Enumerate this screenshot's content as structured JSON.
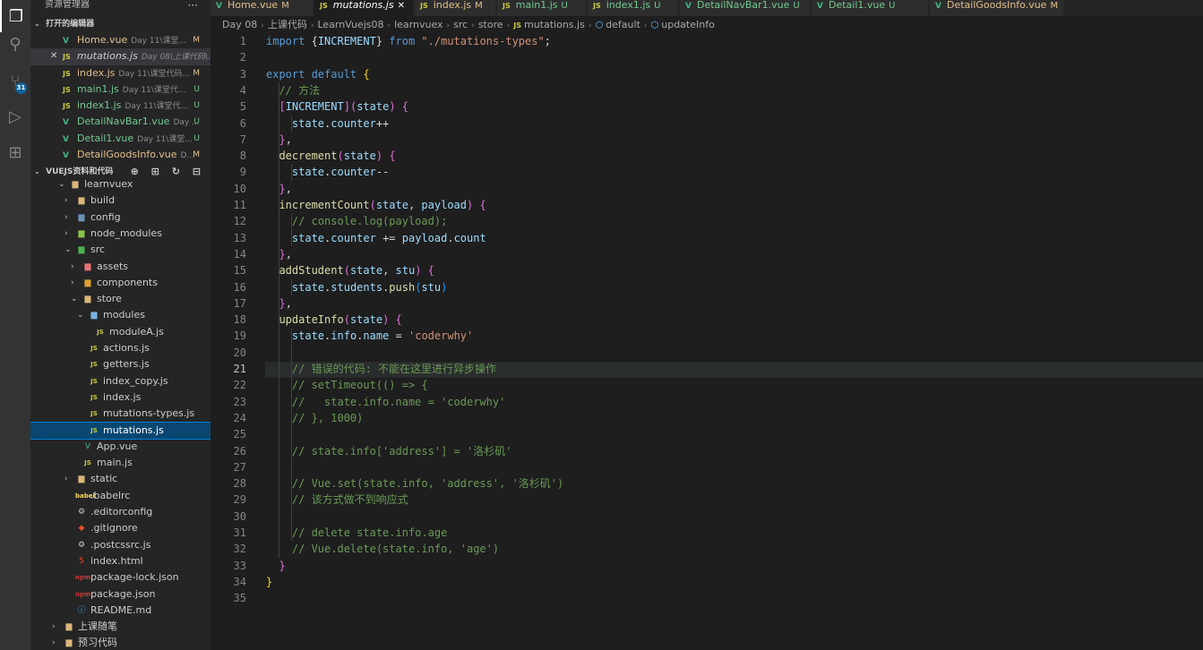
{
  "activity_bar": {
    "items": [
      {
        "name": "explorer-icon",
        "glyph": "❐"
      },
      {
        "name": "search-icon",
        "glyph": "⚲"
      },
      {
        "name": "source-control-icon",
        "glyph": "⑂"
      },
      {
        "name": "run-debug-icon",
        "glyph": "▷"
      },
      {
        "name": "extensions-icon",
        "glyph": "⊞"
      }
    ],
    "scm_badge": "31"
  },
  "sidebar": {
    "title": "资源管理器",
    "more": "···",
    "open_editors": {
      "header": "打开的编辑器",
      "items": [
        {
          "icon": "V",
          "name": "Home.vue",
          "path": "Day 11\\课堂...",
          "status": "M",
          "type": "vue"
        },
        {
          "icon": "JS",
          "name": "mutations.js",
          "path": "Day 08\\上课代码\\...",
          "status": "",
          "type": "js",
          "active": true,
          "close": "✕"
        },
        {
          "icon": "JS",
          "name": "index.js",
          "path": "Day 11\\课堂代码...",
          "status": "M",
          "type": "js"
        },
        {
          "icon": "JS",
          "name": "main1.js",
          "path": "Day 11\\课堂代...",
          "status": "U",
          "type": "js"
        },
        {
          "icon": "JS",
          "name": "index1.js",
          "path": "Day 11\\课堂代...",
          "status": "U",
          "type": "js"
        },
        {
          "icon": "V",
          "name": "DetailNavBar1.vue",
          "path": "Day ...",
          "status": "U",
          "type": "vue"
        },
        {
          "icon": "V",
          "name": "Detail1.vue",
          "path": "Day 11\\课堂...",
          "status": "U",
          "type": "vue"
        },
        {
          "icon": "V",
          "name": "DetailGoodsInfo.vue",
          "path": "D...",
          "status": "M",
          "type": "vue"
        }
      ]
    },
    "workspace": {
      "header": "VUEJS资料和代码",
      "tools": "⊕ ⊞ ↻ ⊟",
      "tree": [
        {
          "label": "learnvuex",
          "icon": "folder-open",
          "depth": 2,
          "arrow": "open"
        },
        {
          "label": "build",
          "icon": "folder",
          "depth": 3,
          "arrow": "closed"
        },
        {
          "label": "config",
          "icon": "folder",
          "depth": 3,
          "arrow": "closed"
        },
        {
          "label": "node_modules",
          "icon": "folder",
          "depth": 3,
          "arrow": "closed"
        },
        {
          "label": "src",
          "icon": "folder-open",
          "depth": 3,
          "arrow": "open"
        },
        {
          "label": "assets",
          "icon": "folder",
          "depth": 4,
          "arrow": "closed"
        },
        {
          "label": "components",
          "icon": "folder",
          "depth": 4,
          "arrow": "closed"
        },
        {
          "label": "store",
          "icon": "folder-open",
          "depth": 4,
          "arrow": "open"
        },
        {
          "label": "modules",
          "icon": "folder-open",
          "depth": 5,
          "arrow": "open"
        },
        {
          "label": "moduleA.js",
          "icon": "js",
          "depth": 6,
          "arrow": ""
        },
        {
          "label": "actions.js",
          "icon": "js",
          "depth": 5,
          "arrow": ""
        },
        {
          "label": "getters.js",
          "icon": "js",
          "depth": 5,
          "arrow": ""
        },
        {
          "label": "index_copy.js",
          "icon": "js",
          "depth": 5,
          "arrow": ""
        },
        {
          "label": "index.js",
          "icon": "js",
          "depth": 5,
          "arrow": ""
        },
        {
          "label": "mutations-types.js",
          "icon": "js",
          "depth": 5,
          "arrow": ""
        },
        {
          "label": "mutations.js",
          "icon": "js",
          "depth": 5,
          "arrow": "",
          "selected": true
        },
        {
          "label": "App.vue",
          "icon": "vue",
          "depth": 4,
          "arrow": ""
        },
        {
          "label": "main.js",
          "icon": "js",
          "depth": 4,
          "arrow": ""
        },
        {
          "label": "static",
          "icon": "folder",
          "depth": 3,
          "arrow": "closed"
        },
        {
          "label": ".babelrc",
          "icon": "babel",
          "depth": 3,
          "arrow": ""
        },
        {
          "label": ".editorconfig",
          "icon": "gear",
          "depth": 3,
          "arrow": ""
        },
        {
          "label": ".gitignore",
          "icon": "git",
          "depth": 3,
          "arrow": ""
        },
        {
          "label": ".postcssrc.js",
          "icon": "gear",
          "depth": 3,
          "arrow": ""
        },
        {
          "label": "index.html",
          "icon": "html",
          "depth": 3,
          "arrow": ""
        },
        {
          "label": "package-lock.json",
          "icon": "npm",
          "depth": 3,
          "arrow": ""
        },
        {
          "label": "package.json",
          "icon": "npm",
          "depth": 3,
          "arrow": ""
        },
        {
          "label": "README.md",
          "icon": "info",
          "depth": 3,
          "arrow": ""
        },
        {
          "label": "上课随笔",
          "icon": "folder",
          "depth": 1,
          "arrow": "closed"
        },
        {
          "label": "预习代码",
          "icon": "folder",
          "depth": 1,
          "arrow": "closed"
        }
      ]
    }
  },
  "tabs": [
    {
      "icon": "V",
      "name": "Home.vue",
      "status": "M",
      "type": "vue"
    },
    {
      "icon": "JS",
      "name": "mutations.js",
      "status": "✕",
      "type": "js",
      "active": true
    },
    {
      "icon": "JS",
      "name": "index.js",
      "status": "M",
      "type": "js"
    },
    {
      "icon": "JS",
      "name": "main1.js",
      "status": "U",
      "type": "js"
    },
    {
      "icon": "JS",
      "name": "index1.js",
      "status": "U",
      "type": "js"
    },
    {
      "icon": "V",
      "name": "DetailNavBar1.vue",
      "status": "U",
      "type": "vue"
    },
    {
      "icon": "V",
      "name": "Detail1.vue",
      "status": "U",
      "type": "vue"
    },
    {
      "icon": "V",
      "name": "DetailGoodsInfo.vue",
      "status": "M",
      "type": "vue"
    }
  ],
  "breadcrumb": [
    "Day 08",
    "上课代码",
    "LearnVuejs08",
    "learnvuex",
    "src",
    "store",
    "mutations.js",
    "default",
    "updateInfo"
  ],
  "editor": {
    "current_line": 21,
    "lines": [
      [
        [
          "k",
          "import "
        ],
        [
          "p",
          "{"
        ],
        [
          "v",
          "INCREMENT"
        ],
        [
          "p",
          "} "
        ],
        [
          "k",
          "from "
        ],
        [
          "s",
          "\"./mutations-types\""
        ],
        [
          "p",
          ";"
        ]
      ],
      [],
      [
        [
          "k",
          "export default "
        ],
        [
          "pr",
          "{"
        ]
      ],
      [
        [
          "p",
          "  "
        ],
        [
          "c",
          "// 方法"
        ]
      ],
      [
        [
          "p",
          "  "
        ],
        [
          "pp",
          "["
        ],
        [
          "v",
          "INCREMENT"
        ],
        [
          "pp",
          "]"
        ],
        [
          "pp",
          "("
        ],
        [
          "v",
          "state"
        ],
        [
          "pp",
          ")"
        ],
        [
          "p",
          " "
        ],
        [
          "pp",
          "{"
        ]
      ],
      [
        [
          "p",
          "    "
        ],
        [
          "v",
          "state"
        ],
        [
          "p",
          "."
        ],
        [
          "v",
          "counter"
        ],
        [
          "p",
          "++"
        ]
      ],
      [
        [
          "p",
          "  "
        ],
        [
          "pp",
          "}"
        ],
        [
          "p",
          ","
        ]
      ],
      [
        [
          "p",
          "  "
        ],
        [
          "f",
          "decrement"
        ],
        [
          "pp",
          "("
        ],
        [
          "v",
          "state"
        ],
        [
          "pp",
          ")"
        ],
        [
          "p",
          " "
        ],
        [
          "pp",
          "{"
        ]
      ],
      [
        [
          "p",
          "    "
        ],
        [
          "v",
          "state"
        ],
        [
          "p",
          "."
        ],
        [
          "v",
          "counter"
        ],
        [
          "p",
          "--"
        ]
      ],
      [
        [
          "p",
          "  "
        ],
        [
          "pp",
          "}"
        ],
        [
          "p",
          ","
        ]
      ],
      [
        [
          "p",
          "  "
        ],
        [
          "f",
          "incrementCount"
        ],
        [
          "pp",
          "("
        ],
        [
          "v",
          "state"
        ],
        [
          "p",
          ", "
        ],
        [
          "v",
          "payload"
        ],
        [
          "pp",
          ")"
        ],
        [
          "p",
          " "
        ],
        [
          "pp",
          "{"
        ]
      ],
      [
        [
          "p",
          "    "
        ],
        [
          "c",
          "// console.log(payload);"
        ]
      ],
      [
        [
          "p",
          "    "
        ],
        [
          "v",
          "state"
        ],
        [
          "p",
          "."
        ],
        [
          "v",
          "counter"
        ],
        [
          "p",
          " += "
        ],
        [
          "v",
          "payload"
        ],
        [
          "p",
          "."
        ],
        [
          "v",
          "count"
        ]
      ],
      [
        [
          "p",
          "  "
        ],
        [
          "pp",
          "}"
        ],
        [
          "p",
          ","
        ]
      ],
      [
        [
          "p",
          "  "
        ],
        [
          "f",
          "addStudent"
        ],
        [
          "pp",
          "("
        ],
        [
          "v",
          "state"
        ],
        [
          "p",
          ", "
        ],
        [
          "v",
          "stu"
        ],
        [
          "pp",
          ")"
        ],
        [
          "p",
          " "
        ],
        [
          "pp",
          "{"
        ]
      ],
      [
        [
          "p",
          "    "
        ],
        [
          "v",
          "state"
        ],
        [
          "p",
          "."
        ],
        [
          "v",
          "students"
        ],
        [
          "p",
          "."
        ],
        [
          "f",
          "push"
        ],
        [
          "pb",
          "("
        ],
        [
          "v",
          "stu"
        ],
        [
          "pb",
          ")"
        ]
      ],
      [
        [
          "p",
          "  "
        ],
        [
          "pp",
          "}"
        ],
        [
          "p",
          ","
        ]
      ],
      [
        [
          "p",
          "  "
        ],
        [
          "f",
          "updateInfo"
        ],
        [
          "pp",
          "("
        ],
        [
          "v",
          "state"
        ],
        [
          "pp",
          ")"
        ],
        [
          "p",
          " "
        ],
        [
          "pp",
          "{"
        ]
      ],
      [
        [
          "p",
          "    "
        ],
        [
          "v",
          "state"
        ],
        [
          "p",
          "."
        ],
        [
          "v",
          "info"
        ],
        [
          "p",
          "."
        ],
        [
          "v",
          "name"
        ],
        [
          "p",
          " = "
        ],
        [
          "s",
          "'coderwhy'"
        ]
      ],
      [],
      [
        [
          "p",
          "    "
        ],
        [
          "c",
          "// 错误的代码: 不能在这里进行异步操作"
        ]
      ],
      [
        [
          "p",
          "    "
        ],
        [
          "c",
          "// setTimeout(() => {"
        ]
      ],
      [
        [
          "p",
          "    "
        ],
        [
          "c",
          "//   state.info.name = 'coderwhy'"
        ]
      ],
      [
        [
          "p",
          "    "
        ],
        [
          "c",
          "// }, 1000)"
        ]
      ],
      [],
      [
        [
          "p",
          "    "
        ],
        [
          "c",
          "// state.info['address'] = '洛杉矶'"
        ]
      ],
      [],
      [
        [
          "p",
          "    "
        ],
        [
          "c",
          "// Vue.set(state.info, 'address', '洛杉矶')"
        ]
      ],
      [
        [
          "p",
          "    "
        ],
        [
          "c",
          "// 该方式做不到响应式"
        ]
      ],
      [],
      [
        [
          "p",
          "    "
        ],
        [
          "c",
          "// delete state.info.age"
        ]
      ],
      [
        [
          "p",
          "    "
        ],
        [
          "c",
          "// Vue.delete(state.info, 'age')"
        ]
      ],
      [
        [
          "p",
          "  "
        ],
        [
          "pp",
          "}"
        ]
      ],
      [
        [
          "pr",
          "}"
        ]
      ],
      []
    ]
  }
}
